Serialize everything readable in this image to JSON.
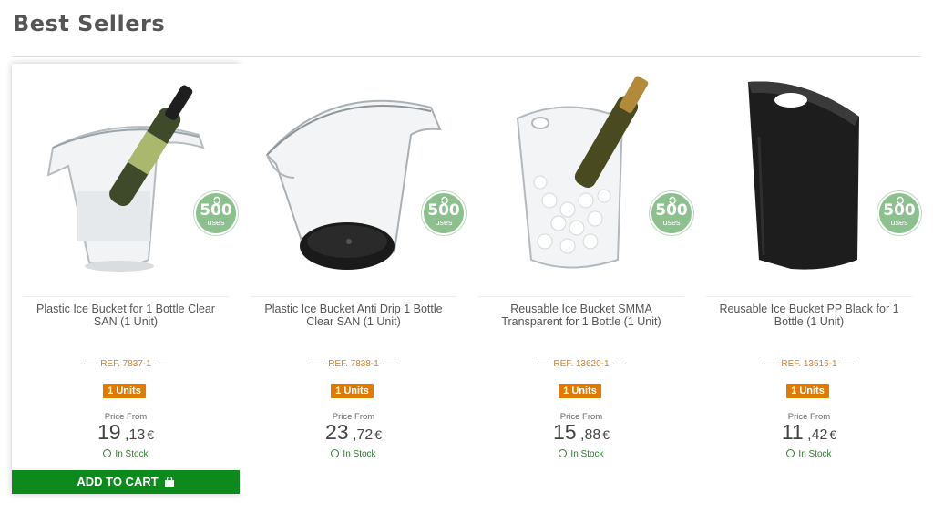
{
  "section": {
    "title": "Best Sellers"
  },
  "products": [
    {
      "name": "Plastic Ice Bucket for 1 Bottle Clear SAN (1 Unit)",
      "ref": "REF. 7837-1",
      "units": "1 Units",
      "price_from": "Price From",
      "price_int": "19",
      "price_dec": "13",
      "currency": "€",
      "stock": "In Stock",
      "badge_number": "500",
      "badge_label": "uses"
    },
    {
      "name": "Plastic Ice Bucket Anti Drip 1 Bottle Clear SAN (1 Unit)",
      "ref": "REF. 7838-1",
      "units": "1 Units",
      "price_from": "Price From",
      "price_int": "23",
      "price_dec": "72",
      "currency": "€",
      "stock": "In Stock",
      "badge_number": "500",
      "badge_label": "uses"
    },
    {
      "name": "Reusable Ice Bucket SMMA Transparent for 1 Bottle (1 Unit)",
      "ref": "REF. 13620-1",
      "units": "1 Units",
      "price_from": "Price From",
      "price_int": "15",
      "price_dec": "88",
      "currency": "€",
      "stock": "In Stock",
      "badge_number": "500",
      "badge_label": "uses"
    },
    {
      "name": "Reusable Ice Bucket PP Black for 1 Bottle (1 Unit)",
      "ref": "REF. 13616-1",
      "units": "1 Units",
      "price_from": "Price From",
      "price_int": "11",
      "price_dec": "42",
      "currency": "€",
      "stock": "In Stock",
      "badge_number": "500",
      "badge_label": "uses"
    }
  ],
  "add_to_cart_label": "ADD TO CART",
  "colors": {
    "ref_orange": "#d0802a",
    "units_badge": "#e07b00",
    "cart_green": "#0c8a1b",
    "stock_green": "#2d7a2d",
    "uses_badge": "#8cc08f"
  },
  "icons": [
    "recycle-icon",
    "check-circle-icon",
    "shopping-bag-icon"
  ]
}
